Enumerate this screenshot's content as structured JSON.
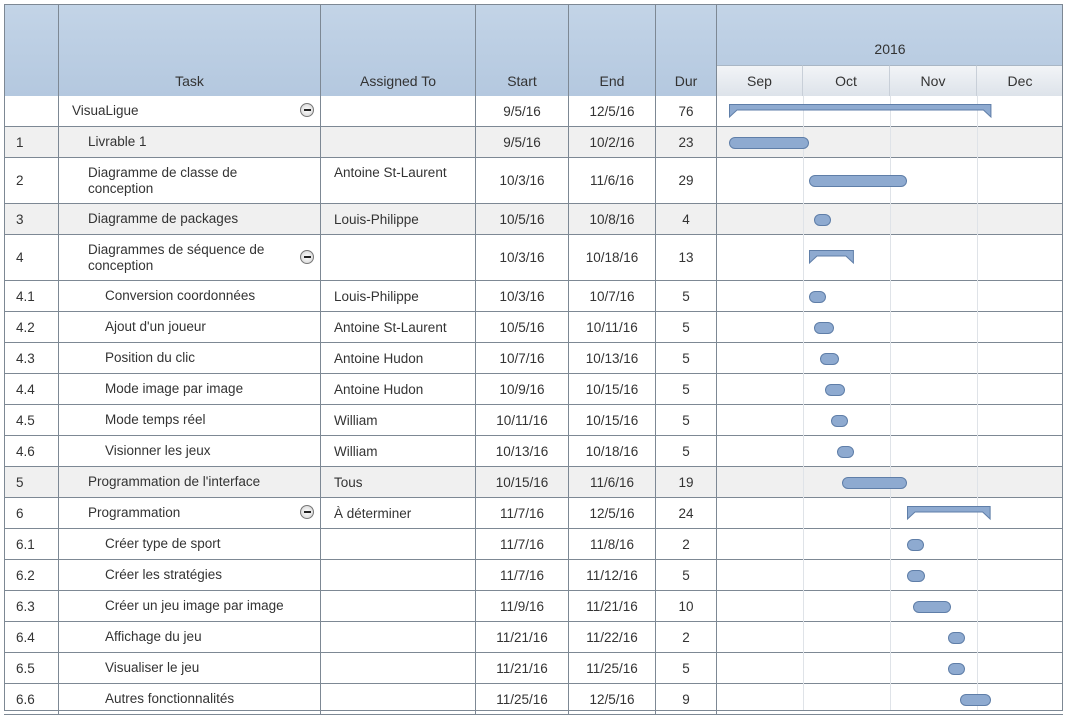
{
  "headers": {
    "id": "",
    "task": "Task",
    "assigned": "Assigned To",
    "start": "Start",
    "end": "End",
    "dur": "Dur"
  },
  "timeline": {
    "year": "2016",
    "months": [
      "Sep",
      "Oct",
      "Nov",
      "Dec"
    ]
  },
  "colors": {
    "bar_fill": "#8eaad0",
    "bar_border": "#5f7ea8",
    "header_bg": "#c3d4e7",
    "alt_row": "#f0f0f0"
  },
  "tasks": [
    {
      "id": "",
      "name": "VisuaLigue",
      "assigned": "",
      "start": "9/5/16",
      "end": "12/5/16",
      "dur": "76",
      "indent": 0,
      "summary": true,
      "collapse": true,
      "alt": false
    },
    {
      "id": "1",
      "name": "Livrable 1",
      "assigned": "",
      "start": "9/5/16",
      "end": "10/2/16",
      "dur": "23",
      "indent": 1,
      "summary": false,
      "collapse": false,
      "alt": true
    },
    {
      "id": "2",
      "name": "Diagramme de classe de conception",
      "assigned": "Antoine St-Laurent",
      "start": "10/3/16",
      "end": "11/6/16",
      "dur": "29",
      "indent": 1,
      "summary": false,
      "collapse": false,
      "alt": false
    },
    {
      "id": "3",
      "name": "Diagramme de packages",
      "assigned": "Louis-Philippe",
      "start": "10/5/16",
      "end": "10/8/16",
      "dur": "4",
      "indent": 1,
      "summary": false,
      "collapse": false,
      "alt": true
    },
    {
      "id": "4",
      "name": "Diagrammes de séquence de conception",
      "assigned": "",
      "start": "10/3/16",
      "end": "10/18/16",
      "dur": "13",
      "indent": 1,
      "summary": true,
      "collapse": true,
      "alt": false
    },
    {
      "id": "4.1",
      "name": "Conversion coordonnées",
      "assigned": "Louis-Philippe",
      "start": "10/3/16",
      "end": "10/7/16",
      "dur": "5",
      "indent": 2,
      "summary": false,
      "collapse": false,
      "alt": false
    },
    {
      "id": "4.2",
      "name": "Ajout d'un joueur",
      "assigned": "Antoine St-Laurent",
      "start": "10/5/16",
      "end": "10/11/16",
      "dur": "5",
      "indent": 2,
      "summary": false,
      "collapse": false,
      "alt": false
    },
    {
      "id": "4.3",
      "name": "Position du clic",
      "assigned": "Antoine Hudon",
      "start": "10/7/16",
      "end": "10/13/16",
      "dur": "5",
      "indent": 2,
      "summary": false,
      "collapse": false,
      "alt": false
    },
    {
      "id": "4.4",
      "name": "Mode image par image",
      "assigned": "Antoine Hudon",
      "start": "10/9/16",
      "end": "10/15/16",
      "dur": "5",
      "indent": 2,
      "summary": false,
      "collapse": false,
      "alt": false
    },
    {
      "id": "4.5",
      "name": "Mode temps réel",
      "assigned": "William",
      "start": "10/11/16",
      "end": "10/15/16",
      "dur": "5",
      "indent": 2,
      "summary": false,
      "collapse": false,
      "alt": false
    },
    {
      "id": "4.6",
      "name": "Visionner les jeux",
      "assigned": "William",
      "start": "10/13/16",
      "end": "10/18/16",
      "dur": "5",
      "indent": 2,
      "summary": false,
      "collapse": false,
      "alt": false
    },
    {
      "id": "5",
      "name": "Programmation de l'interface",
      "assigned": "Tous",
      "start": "10/15/16",
      "end": "11/6/16",
      "dur": "19",
      "indent": 1,
      "summary": false,
      "collapse": false,
      "alt": true
    },
    {
      "id": "6",
      "name": "Programmation",
      "assigned": "À déterminer",
      "start": "11/7/16",
      "end": "12/5/16",
      "dur": "24",
      "indent": 1,
      "summary": true,
      "collapse": true,
      "alt": false
    },
    {
      "id": "6.1",
      "name": "Créer type de sport",
      "assigned": "",
      "start": "11/7/16",
      "end": "11/8/16",
      "dur": "2",
      "indent": 2,
      "summary": false,
      "collapse": false,
      "alt": false
    },
    {
      "id": "6.2",
      "name": "Créer les stratégies",
      "assigned": "",
      "start": "11/7/16",
      "end": "11/12/16",
      "dur": "5",
      "indent": 2,
      "summary": false,
      "collapse": false,
      "alt": false
    },
    {
      "id": "6.3",
      "name": "Créer un jeu image par image",
      "assigned": "",
      "start": "11/9/16",
      "end": "11/21/16",
      "dur": "10",
      "indent": 2,
      "summary": false,
      "collapse": false,
      "alt": false
    },
    {
      "id": "6.4",
      "name": "Affichage du jeu",
      "assigned": "",
      "start": "11/21/16",
      "end": "11/22/16",
      "dur": "2",
      "indent": 2,
      "summary": false,
      "collapse": false,
      "alt": false
    },
    {
      "id": "6.5",
      "name": "Visualiser le jeu",
      "assigned": "",
      "start": "11/21/16",
      "end": "11/25/16",
      "dur": "5",
      "indent": 2,
      "summary": false,
      "collapse": false,
      "alt": false
    },
    {
      "id": "6.6",
      "name": "Autres fonctionnalités",
      "assigned": "",
      "start": "11/25/16",
      "end": "12/5/16",
      "dur": "9",
      "indent": 2,
      "summary": false,
      "collapse": false,
      "alt": false
    }
  ]
}
